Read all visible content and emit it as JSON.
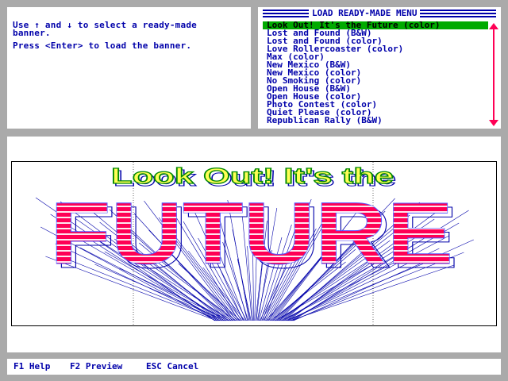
{
  "instructions": {
    "line1": "Use ↑ and ↓ to select a ready-made",
    "line2": "banner.",
    "line3": "Press <Enter> to load the banner."
  },
  "menu": {
    "title": "LOAD READY-MADE MENU",
    "items": [
      "Look Out! It's the Future (color)",
      "Lost and Found (B&W)",
      "Lost and Found (color)",
      "Love Rollercoaster (color)",
      "Max (color)",
      "New Mexico (B&W)",
      "New Mexico (color)",
      "No Smoking (color)",
      "Open House (B&W)",
      "Open House (color)",
      "Photo Contest (color)",
      "Quiet Please (color)",
      "Republican Rally (B&W)"
    ],
    "selected_index": 0
  },
  "banner_preview": {
    "headline": "Look Out! It's the",
    "big_text": "FUTURE",
    "headline_color": "#ffff55",
    "big_text_color": "#ff0055",
    "ray_color": "#0000aa"
  },
  "status_bar": {
    "help": "F1 Help",
    "preview": "F2 Preview",
    "cancel": "ESC Cancel"
  },
  "colors": {
    "background": "#aaaaaa",
    "text": "#0000aa",
    "selection": "#00aa00",
    "scroll_arrow": "#ff0055"
  }
}
